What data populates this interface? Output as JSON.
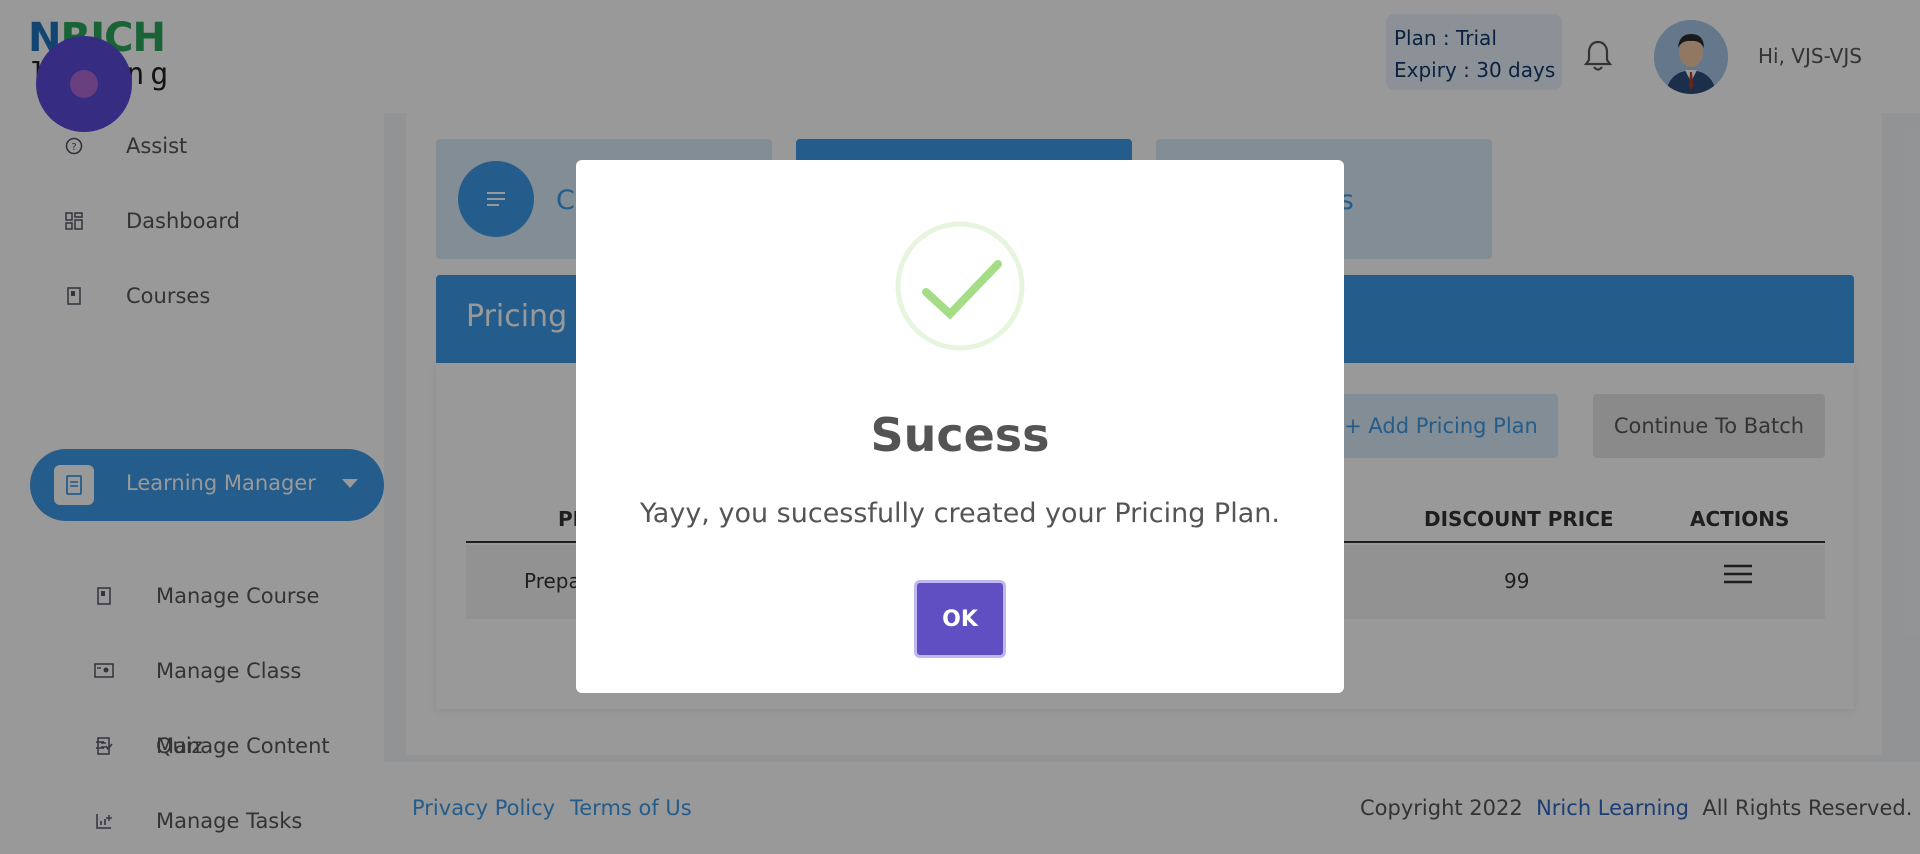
{
  "header": {
    "logo_top_a": "N",
    "logo_top_b": "RICH",
    "logo_bottom": "l  i  ng",
    "plan_line": "Plan   : Trial",
    "expiry_line": "Expiry : 30 days",
    "greeting": "Hi, VJS-VJS"
  },
  "sidebar": {
    "items": [
      {
        "label": "Assist",
        "icon": "help-circle-icon"
      },
      {
        "label": "Dashboard",
        "icon": "grid-icon"
      },
      {
        "label": "Courses",
        "icon": "book-icon"
      },
      {
        "label": "Learning Manager",
        "icon": "document-icon"
      },
      {
        "label": "Manage Course",
        "icon": "book-icon"
      },
      {
        "label": "Manage Class",
        "icon": "screen-icon"
      },
      {
        "label": "Manage Content",
        "icon": "file-edit-icon"
      },
      {
        "label": "Manage Tasks",
        "icon": "chart-plus-icon"
      },
      {
        "label": "Quiz",
        "icon": "list-check-icon"
      }
    ]
  },
  "main": {
    "stat_cards": [
      {
        "label": "C"
      },
      {
        "label": ""
      },
      {
        "label": "nes"
      }
    ],
    "panel_title": "Pricing",
    "add_button": "+ Add Pricing Plan",
    "continue_button": "Continue To Batch",
    "table": {
      "columns": [
        "PL",
        "DISCOUNT PRICE",
        "ACTIONS"
      ],
      "rows": [
        {
          "name": "Prepa",
          "discount_price": "99"
        }
      ]
    }
  },
  "footer": {
    "privacy": "Privacy Policy",
    "terms": "Terms of Us",
    "copyright": "Copyright 2022",
    "brand": "Nrich Learning",
    "rights": "All Rights Reserved."
  },
  "modal": {
    "title": "Sucess",
    "message": "Yayy, you sucessfully created your Pricing Plan.",
    "ok_label": "OK",
    "check_color": "#a5dc86"
  },
  "colors": {
    "primary": "#3d9ae8",
    "accent": "#5f4fc2",
    "fab": "#5b4bdb"
  }
}
